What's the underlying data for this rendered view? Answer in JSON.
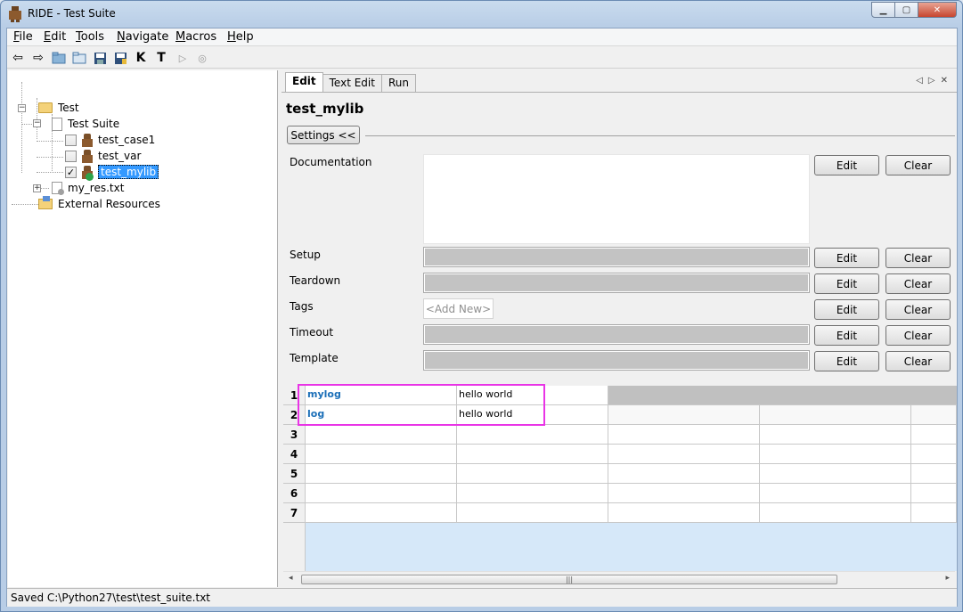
{
  "window": {
    "title": "RIDE - Test Suite"
  },
  "menu": [
    {
      "key": "F",
      "rest": "ile"
    },
    {
      "key": "E",
      "rest": "dit"
    },
    {
      "key": "T",
      "rest": "ools"
    },
    {
      "key": "N",
      "rest": "avigate"
    },
    {
      "key": "M",
      "rest": "acros"
    },
    {
      "key": "H",
      "rest": "elp"
    }
  ],
  "toolbar": {
    "icons": [
      "back-arrow-icon",
      "forward-arrow-icon",
      "open-directory-icon",
      "open-folder-icon",
      "save-icon",
      "save-all-icon",
      "keyword-search-icon",
      "test-search-icon",
      "run-icon",
      "stop-icon"
    ]
  },
  "tree": {
    "root": "Test",
    "suite": "Test Suite",
    "tests": [
      "test_case1",
      "test_var",
      "test_mylib"
    ],
    "test_mylib_checked": true,
    "resource": "my_res.txt",
    "external": "External Resources"
  },
  "tabs": [
    "Edit",
    "Text Edit",
    "Run"
  ],
  "editor": {
    "title": "test_mylib",
    "settings_toggle": "Settings <<",
    "labels": {
      "documentation": "Documentation",
      "setup": "Setup",
      "teardown": "Teardown",
      "tags": "Tags",
      "timeout": "Timeout",
      "template": "Template"
    },
    "edit_label": "Edit",
    "clear_label": "Clear",
    "add_new_placeholder": "<Add New>"
  },
  "grid": {
    "row_numbers": [
      "1",
      "2",
      "3",
      "4",
      "5",
      "6",
      "7"
    ],
    "rows": [
      {
        "keyword": "mylog",
        "arg": "hello world"
      },
      {
        "keyword": "log",
        "arg": "hello world"
      }
    ]
  },
  "status": "Saved C:\\Python27\\test\\test_suite.txt"
}
